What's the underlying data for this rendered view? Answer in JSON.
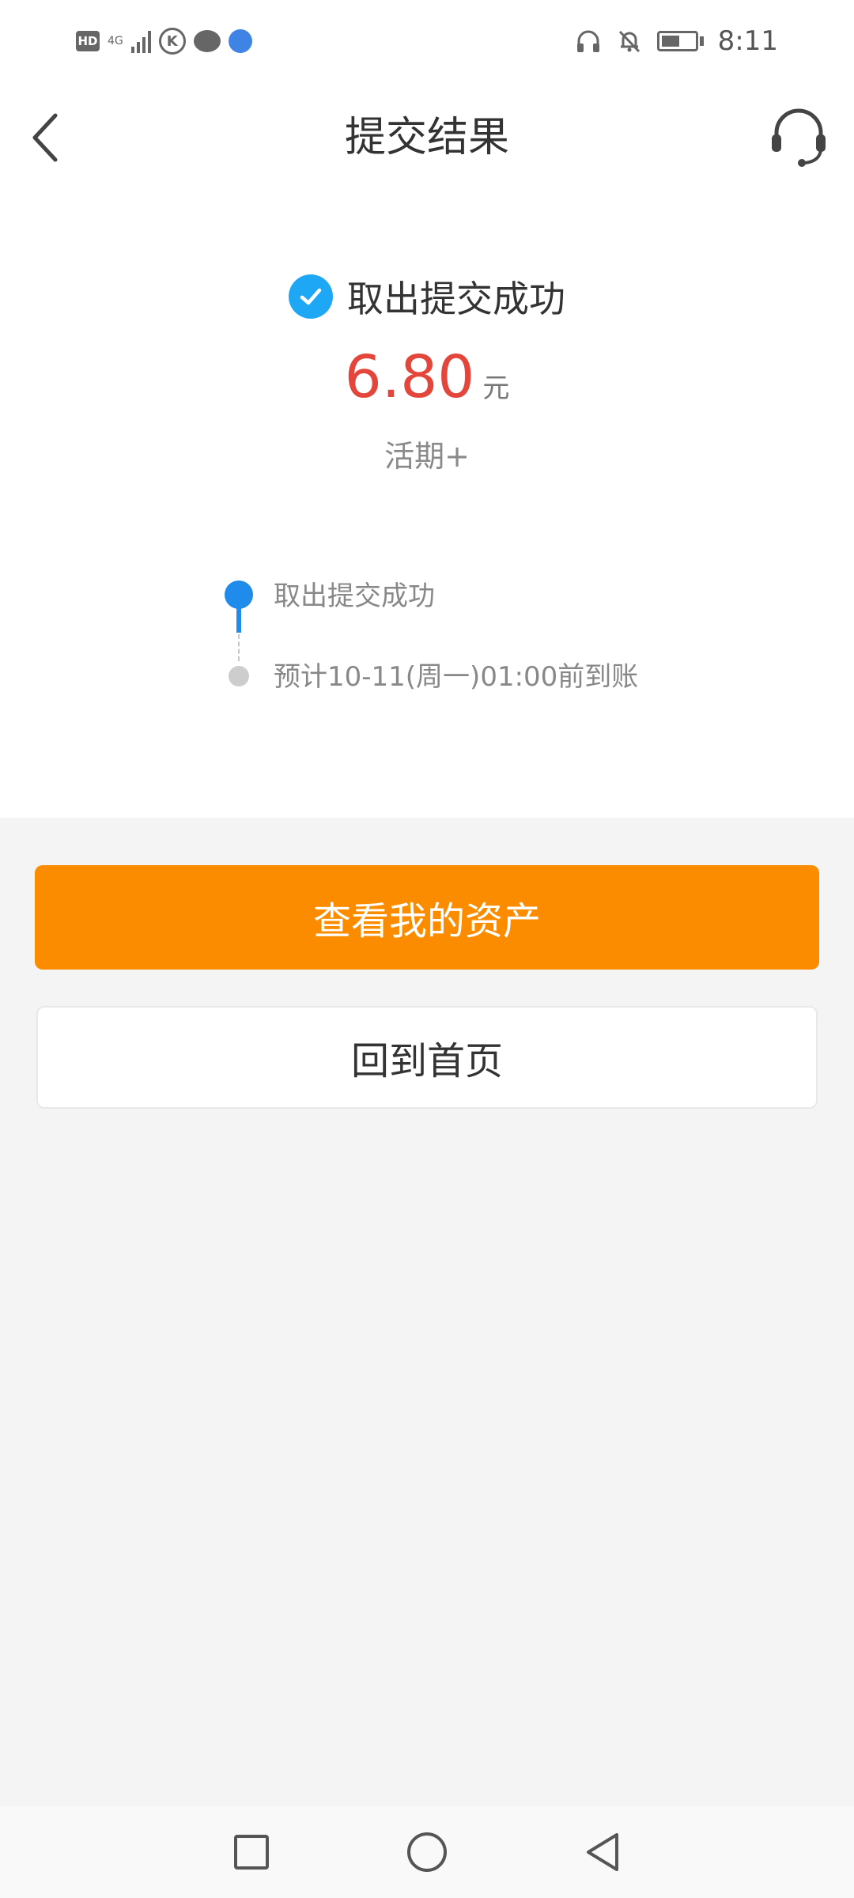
{
  "status_bar": {
    "left_icons": [
      "hd-badge-icon",
      "signal-icon",
      "k-app-icon",
      "chat-icon",
      "globe-icon"
    ],
    "hd_label": "HD",
    "network": "4G",
    "right_icons": [
      "headphone-icon",
      "mute-bell-icon",
      "battery-icon"
    ],
    "time": "8:11"
  },
  "header": {
    "title": "提交结果",
    "back_icon": "chevron-left-icon",
    "service_icon": "headset-icon"
  },
  "result": {
    "status_text": "取出提交成功",
    "amount": "6.80",
    "unit": "元",
    "product": "活期+"
  },
  "timeline": {
    "steps": [
      {
        "label": "取出提交成功",
        "state": "done"
      },
      {
        "label": "预计10-11(周一)01:00前到账",
        "state": "pending"
      }
    ]
  },
  "buttons": {
    "primary_label": "查看我的资产",
    "secondary_label": "回到首页"
  },
  "nav_bar": {
    "icons": [
      "recent-apps-icon",
      "home-icon",
      "back-icon"
    ]
  },
  "colors": {
    "accent_orange": "#fb8c00",
    "amount_red": "#e5463b",
    "check_blue": "#1ea7f5",
    "timeline_blue": "#1f8ceb"
  }
}
